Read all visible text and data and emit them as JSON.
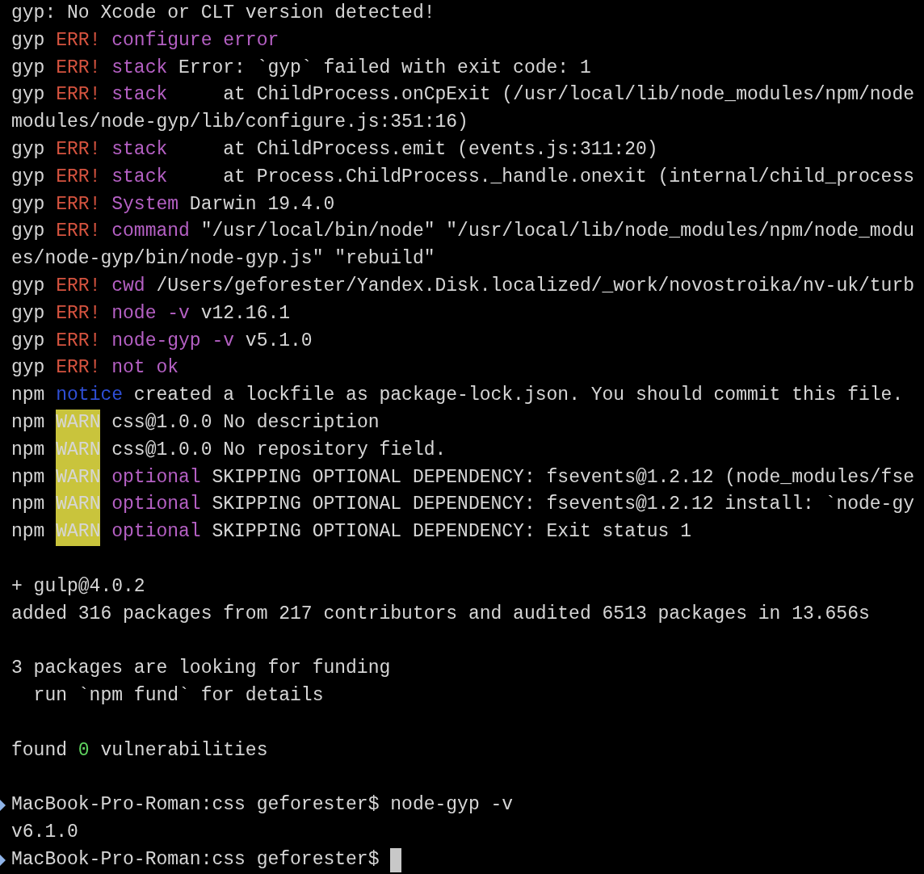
{
  "terminal": {
    "lines": [
      {
        "kind": "output",
        "segments": [
          {
            "kind": "plain",
            "text": "gyp: No Xcode or CLT version detected!"
          }
        ]
      },
      {
        "kind": "output",
        "segments": [
          {
            "kind": "plain",
            "text": "gyp"
          },
          {
            "kind": "error",
            "text": "ERR!"
          },
          {
            "kind": "keyword",
            "text": "configure error"
          }
        ]
      },
      {
        "kind": "output",
        "segments": [
          {
            "kind": "plain",
            "text": "gyp"
          },
          {
            "kind": "error",
            "text": "ERR!"
          },
          {
            "kind": "keyword",
            "text": "stack"
          },
          {
            "kind": "plain",
            "text": "Error: `gyp` failed with exit code: 1"
          }
        ]
      },
      {
        "kind": "output",
        "segments": [
          {
            "kind": "plain",
            "text": "gyp"
          },
          {
            "kind": "error",
            "text": "ERR!"
          },
          {
            "kind": "keyword",
            "text": "stack"
          },
          {
            "kind": "plain",
            "text": "    at ChildProcess.onCpExit (/usr/local/lib/node_modules/npm/node"
          }
        ]
      },
      {
        "kind": "output",
        "segments": [
          {
            "kind": "plain",
            "text": "modules/node-gyp/lib/configure.js:351:16)"
          }
        ]
      },
      {
        "kind": "output",
        "segments": [
          {
            "kind": "plain",
            "text": "gyp"
          },
          {
            "kind": "error",
            "text": "ERR!"
          },
          {
            "kind": "keyword",
            "text": "stack"
          },
          {
            "kind": "plain",
            "text": "    at ChildProcess.emit (events.js:311:20)"
          }
        ]
      },
      {
        "kind": "output",
        "segments": [
          {
            "kind": "plain",
            "text": "gyp"
          },
          {
            "kind": "error",
            "text": "ERR!"
          },
          {
            "kind": "keyword",
            "text": "stack"
          },
          {
            "kind": "plain",
            "text": "    at Process.ChildProcess._handle.onexit (internal/child_process"
          }
        ]
      },
      {
        "kind": "output",
        "segments": [
          {
            "kind": "plain",
            "text": "gyp"
          },
          {
            "kind": "error",
            "text": "ERR!"
          },
          {
            "kind": "keyword",
            "text": "System"
          },
          {
            "kind": "plain",
            "text": "Darwin 19.4.0"
          }
        ]
      },
      {
        "kind": "output",
        "segments": [
          {
            "kind": "plain",
            "text": "gyp"
          },
          {
            "kind": "error",
            "text": "ERR!"
          },
          {
            "kind": "keyword",
            "text": "command"
          },
          {
            "kind": "plain",
            "text": "\"/usr/local/bin/node\" \"/usr/local/lib/node_modules/npm/node_modu"
          }
        ]
      },
      {
        "kind": "output",
        "segments": [
          {
            "kind": "plain",
            "text": "es/node-gyp/bin/node-gyp.js\" \"rebuild\""
          }
        ]
      },
      {
        "kind": "output",
        "segments": [
          {
            "kind": "plain",
            "text": "gyp"
          },
          {
            "kind": "error",
            "text": "ERR!"
          },
          {
            "kind": "keyword",
            "text": "cwd"
          },
          {
            "kind": "plain",
            "text": "/Users/geforester/Yandex.Disk.localized/_work/novostroika/nv-uk/turb"
          }
        ]
      },
      {
        "kind": "output",
        "segments": [
          {
            "kind": "plain",
            "text": "gyp"
          },
          {
            "kind": "error",
            "text": "ERR!"
          },
          {
            "kind": "keyword",
            "text": "node -v"
          },
          {
            "kind": "plain",
            "text": "v12.16.1"
          }
        ]
      },
      {
        "kind": "output",
        "segments": [
          {
            "kind": "plain",
            "text": "gyp"
          },
          {
            "kind": "error",
            "text": "ERR!"
          },
          {
            "kind": "keyword",
            "text": "node-gyp -v"
          },
          {
            "kind": "plain",
            "text": "v5.1.0"
          }
        ]
      },
      {
        "kind": "output",
        "segments": [
          {
            "kind": "plain",
            "text": "gyp"
          },
          {
            "kind": "error",
            "text": "ERR!"
          },
          {
            "kind": "keyword",
            "text": "not ok"
          }
        ]
      },
      {
        "kind": "output",
        "segments": [
          {
            "kind": "plain",
            "text": "npm"
          },
          {
            "kind": "notice",
            "text": "notice"
          },
          {
            "kind": "plain",
            "text": "created a lockfile as package-lock.json. You should commit this file."
          }
        ]
      },
      {
        "kind": "output",
        "segments": [
          {
            "kind": "plain",
            "text": "npm"
          },
          {
            "kind": "warn",
            "text": "WARN"
          },
          {
            "kind": "plain",
            "text": "css@1.0.0 No description"
          }
        ]
      },
      {
        "kind": "output",
        "segments": [
          {
            "kind": "plain",
            "text": "npm"
          },
          {
            "kind": "warn",
            "text": "WARN"
          },
          {
            "kind": "plain",
            "text": "css@1.0.0 No repository field."
          }
        ]
      },
      {
        "kind": "output",
        "segments": [
          {
            "kind": "plain",
            "text": "npm"
          },
          {
            "kind": "warn",
            "text": "WARN"
          },
          {
            "kind": "keyword",
            "text": "optional"
          },
          {
            "kind": "plain",
            "text": "SKIPPING OPTIONAL DEPENDENCY: fsevents@1.2.12 (node_modules/fse"
          }
        ]
      },
      {
        "kind": "output",
        "segments": [
          {
            "kind": "plain",
            "text": "npm"
          },
          {
            "kind": "warn",
            "text": "WARN"
          },
          {
            "kind": "keyword",
            "text": "optional"
          },
          {
            "kind": "plain",
            "text": "SKIPPING OPTIONAL DEPENDENCY: fsevents@1.2.12 install: `node-gy"
          }
        ]
      },
      {
        "kind": "output",
        "segments": [
          {
            "kind": "plain",
            "text": "npm"
          },
          {
            "kind": "warn",
            "text": "WARN"
          },
          {
            "kind": "keyword",
            "text": "optional"
          },
          {
            "kind": "plain",
            "text": "SKIPPING OPTIONAL DEPENDENCY: Exit status 1"
          }
        ]
      },
      {
        "kind": "blank"
      },
      {
        "kind": "output",
        "segments": [
          {
            "kind": "plain",
            "text": "+ gulp@4.0.2"
          }
        ]
      },
      {
        "kind": "output",
        "segments": [
          {
            "kind": "plain",
            "text": "added 316 packages from 217 contributors and audited 6513 packages in 13.656s"
          }
        ]
      },
      {
        "kind": "blank"
      },
      {
        "kind": "output",
        "segments": [
          {
            "kind": "plain",
            "text": "3 packages are looking for funding"
          }
        ]
      },
      {
        "kind": "output",
        "segments": [
          {
            "kind": "plain",
            "text": "  run `npm fund` for details"
          }
        ]
      },
      {
        "kind": "blank"
      },
      {
        "kind": "output",
        "segments": [
          {
            "kind": "plain",
            "text": "found"
          },
          {
            "kind": "success",
            "text": "0"
          },
          {
            "kind": "plain",
            "text": "vulnerabilities"
          }
        ]
      },
      {
        "kind": "blank"
      },
      {
        "kind": "prompt",
        "segments": [
          {
            "kind": "plain",
            "text": "MacBook-Pro-Roman:css geforester$"
          },
          {
            "kind": "plain",
            "text": "node-gyp -v"
          }
        ]
      },
      {
        "kind": "output",
        "segments": [
          {
            "kind": "plain",
            "text": "v6.1.0"
          }
        ]
      },
      {
        "kind": "prompt",
        "cursor": true,
        "segments": [
          {
            "kind": "plain",
            "text": "MacBook-Pro-Roman:css geforester$"
          }
        ]
      }
    ]
  }
}
